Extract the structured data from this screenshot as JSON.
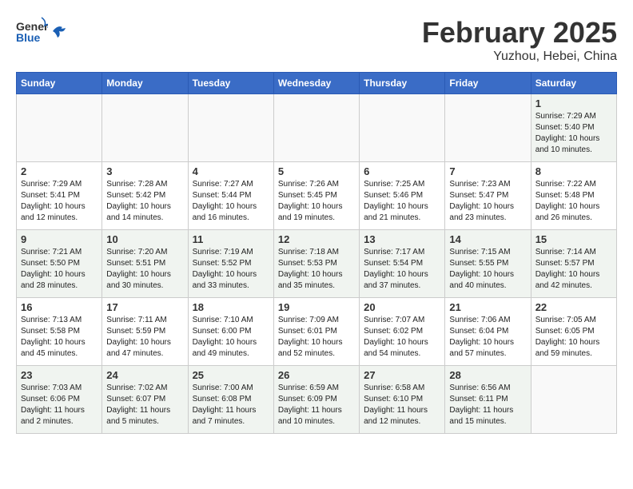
{
  "header": {
    "logo_line1": "General",
    "logo_line2": "Blue",
    "month": "February 2025",
    "location": "Yuzhou, Hebei, China"
  },
  "days_of_week": [
    "Sunday",
    "Monday",
    "Tuesday",
    "Wednesday",
    "Thursday",
    "Friday",
    "Saturday"
  ],
  "weeks": [
    [
      {
        "day": "",
        "info": ""
      },
      {
        "day": "",
        "info": ""
      },
      {
        "day": "",
        "info": ""
      },
      {
        "day": "",
        "info": ""
      },
      {
        "day": "",
        "info": ""
      },
      {
        "day": "",
        "info": ""
      },
      {
        "day": "1",
        "info": "Sunrise: 7:29 AM\nSunset: 5:40 PM\nDaylight: 10 hours\nand 10 minutes."
      }
    ],
    [
      {
        "day": "2",
        "info": "Sunrise: 7:29 AM\nSunset: 5:41 PM\nDaylight: 10 hours\nand 12 minutes."
      },
      {
        "day": "3",
        "info": "Sunrise: 7:28 AM\nSunset: 5:42 PM\nDaylight: 10 hours\nand 14 minutes."
      },
      {
        "day": "4",
        "info": "Sunrise: 7:27 AM\nSunset: 5:44 PM\nDaylight: 10 hours\nand 16 minutes."
      },
      {
        "day": "5",
        "info": "Sunrise: 7:26 AM\nSunset: 5:45 PM\nDaylight: 10 hours\nand 19 minutes."
      },
      {
        "day": "6",
        "info": "Sunrise: 7:25 AM\nSunset: 5:46 PM\nDaylight: 10 hours\nand 21 minutes."
      },
      {
        "day": "7",
        "info": "Sunrise: 7:23 AM\nSunset: 5:47 PM\nDaylight: 10 hours\nand 23 minutes."
      },
      {
        "day": "8",
        "info": "Sunrise: 7:22 AM\nSunset: 5:48 PM\nDaylight: 10 hours\nand 26 minutes."
      }
    ],
    [
      {
        "day": "9",
        "info": "Sunrise: 7:21 AM\nSunset: 5:50 PM\nDaylight: 10 hours\nand 28 minutes."
      },
      {
        "day": "10",
        "info": "Sunrise: 7:20 AM\nSunset: 5:51 PM\nDaylight: 10 hours\nand 30 minutes."
      },
      {
        "day": "11",
        "info": "Sunrise: 7:19 AM\nSunset: 5:52 PM\nDaylight: 10 hours\nand 33 minutes."
      },
      {
        "day": "12",
        "info": "Sunrise: 7:18 AM\nSunset: 5:53 PM\nDaylight: 10 hours\nand 35 minutes."
      },
      {
        "day": "13",
        "info": "Sunrise: 7:17 AM\nSunset: 5:54 PM\nDaylight: 10 hours\nand 37 minutes."
      },
      {
        "day": "14",
        "info": "Sunrise: 7:15 AM\nSunset: 5:55 PM\nDaylight: 10 hours\nand 40 minutes."
      },
      {
        "day": "15",
        "info": "Sunrise: 7:14 AM\nSunset: 5:57 PM\nDaylight: 10 hours\nand 42 minutes."
      }
    ],
    [
      {
        "day": "16",
        "info": "Sunrise: 7:13 AM\nSunset: 5:58 PM\nDaylight: 10 hours\nand 45 minutes."
      },
      {
        "day": "17",
        "info": "Sunrise: 7:11 AM\nSunset: 5:59 PM\nDaylight: 10 hours\nand 47 minutes."
      },
      {
        "day": "18",
        "info": "Sunrise: 7:10 AM\nSunset: 6:00 PM\nDaylight: 10 hours\nand 49 minutes."
      },
      {
        "day": "19",
        "info": "Sunrise: 7:09 AM\nSunset: 6:01 PM\nDaylight: 10 hours\nand 52 minutes."
      },
      {
        "day": "20",
        "info": "Sunrise: 7:07 AM\nSunset: 6:02 PM\nDaylight: 10 hours\nand 54 minutes."
      },
      {
        "day": "21",
        "info": "Sunrise: 7:06 AM\nSunset: 6:04 PM\nDaylight: 10 hours\nand 57 minutes."
      },
      {
        "day": "22",
        "info": "Sunrise: 7:05 AM\nSunset: 6:05 PM\nDaylight: 10 hours\nand 59 minutes."
      }
    ],
    [
      {
        "day": "23",
        "info": "Sunrise: 7:03 AM\nSunset: 6:06 PM\nDaylight: 11 hours\nand 2 minutes."
      },
      {
        "day": "24",
        "info": "Sunrise: 7:02 AM\nSunset: 6:07 PM\nDaylight: 11 hours\nand 5 minutes."
      },
      {
        "day": "25",
        "info": "Sunrise: 7:00 AM\nSunset: 6:08 PM\nDaylight: 11 hours\nand 7 minutes."
      },
      {
        "day": "26",
        "info": "Sunrise: 6:59 AM\nSunset: 6:09 PM\nDaylight: 11 hours\nand 10 minutes."
      },
      {
        "day": "27",
        "info": "Sunrise: 6:58 AM\nSunset: 6:10 PM\nDaylight: 11 hours\nand 12 minutes."
      },
      {
        "day": "28",
        "info": "Sunrise: 6:56 AM\nSunset: 6:11 PM\nDaylight: 11 hours\nand 15 minutes."
      },
      {
        "day": "",
        "info": ""
      }
    ]
  ]
}
